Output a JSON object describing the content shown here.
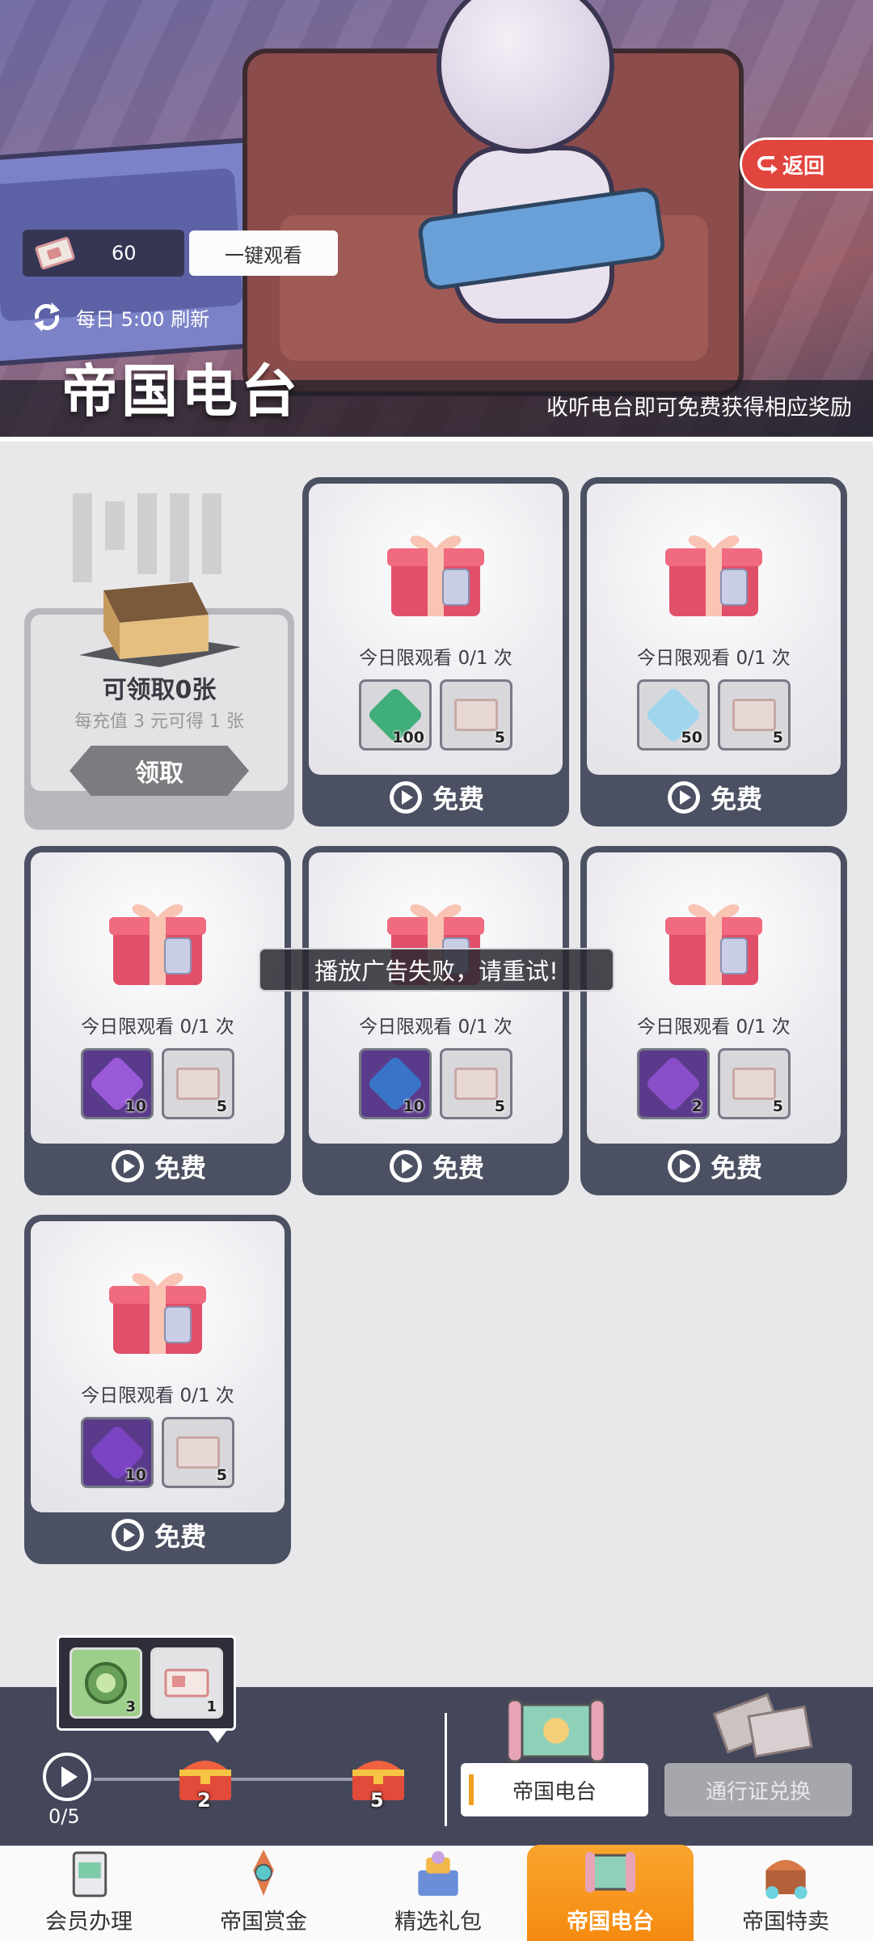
{
  "header": {
    "currency_value": "60",
    "watch_all_label": "一键观看",
    "refresh_text": "每日 5:00 刷新",
    "title": "帝国电台",
    "subtitle": "收听电台即可免费获得相应奖励",
    "back_label": "返回"
  },
  "claim": {
    "title": "可领取0张",
    "desc": "每充值 3 元可得 1 张",
    "button": "领取"
  },
  "cards": [
    {
      "limit": "今日限观看 0/1 次",
      "reward1_icon": "green-gem-icon",
      "reward1_count": "100",
      "reward2_icon": "ticket-icon",
      "reward2_count": "5",
      "free_label": "免费"
    },
    {
      "limit": "今日限观看 0/1 次",
      "reward1_icon": "crystal-cube-icon",
      "reward1_count": "50",
      "reward2_icon": "ticket-icon",
      "reward2_count": "5",
      "free_label": "免费"
    },
    {
      "limit": "今日限观看 0/1 次",
      "reward1_icon": "purple-powder-icon",
      "reward1_count": "10",
      "reward2_icon": "ticket-icon",
      "reward2_count": "5",
      "free_label": "免费"
    },
    {
      "limit": "今日限观看 0/1 次",
      "reward1_icon": "blue-crystal-pile-icon",
      "reward1_count": "10",
      "reward2_icon": "ticket-icon",
      "reward2_count": "5",
      "free_label": "免费"
    },
    {
      "limit": "今日限观看 0/1 次",
      "reward1_icon": "purple-device-icon",
      "reward1_count": "2",
      "reward2_icon": "ticket-icon",
      "reward2_count": "5",
      "free_label": "免费"
    },
    {
      "limit": "今日限观看 0/1 次",
      "reward1_icon": "purple-ticket-icon",
      "reward1_count": "10",
      "reward2_icon": "ticket-icon",
      "reward2_count": "5",
      "free_label": "免费"
    }
  ],
  "toast": "播放广告失败，请重试!",
  "progress": {
    "label": "0/5",
    "tip_item1_count": "3",
    "tip_item2_count": "1",
    "chest1_label": "2",
    "chest2_label": "5"
  },
  "subtabs": {
    "station": "帝国电台",
    "pass": "通行证兑换"
  },
  "nav": [
    {
      "label": "会员办理"
    },
    {
      "label": "帝国赏金"
    },
    {
      "label": "精选礼包"
    },
    {
      "label": "帝国电台"
    },
    {
      "label": "帝国特卖"
    }
  ],
  "colors": {
    "active_tab": "#f59a1e",
    "card_frame": "#4b5062",
    "back_button": "#e2443e"
  }
}
